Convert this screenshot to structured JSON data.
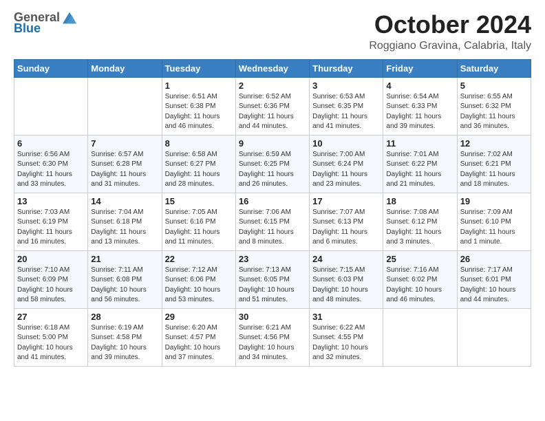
{
  "header": {
    "logo": {
      "general": "General",
      "blue": "Blue"
    },
    "title": "October 2024",
    "location": "Roggiano Gravina, Calabria, Italy"
  },
  "columns": [
    "Sunday",
    "Monday",
    "Tuesday",
    "Wednesday",
    "Thursday",
    "Friday",
    "Saturday"
  ],
  "weeks": [
    [
      {
        "day": "",
        "info": ""
      },
      {
        "day": "",
        "info": ""
      },
      {
        "day": "1",
        "info": "Sunrise: 6:51 AM\nSunset: 6:38 PM\nDaylight: 11 hours and 46 minutes."
      },
      {
        "day": "2",
        "info": "Sunrise: 6:52 AM\nSunset: 6:36 PM\nDaylight: 11 hours and 44 minutes."
      },
      {
        "day": "3",
        "info": "Sunrise: 6:53 AM\nSunset: 6:35 PM\nDaylight: 11 hours and 41 minutes."
      },
      {
        "day": "4",
        "info": "Sunrise: 6:54 AM\nSunset: 6:33 PM\nDaylight: 11 hours and 39 minutes."
      },
      {
        "day": "5",
        "info": "Sunrise: 6:55 AM\nSunset: 6:32 PM\nDaylight: 11 hours and 36 minutes."
      }
    ],
    [
      {
        "day": "6",
        "info": "Sunrise: 6:56 AM\nSunset: 6:30 PM\nDaylight: 11 hours and 33 minutes."
      },
      {
        "day": "7",
        "info": "Sunrise: 6:57 AM\nSunset: 6:28 PM\nDaylight: 11 hours and 31 minutes."
      },
      {
        "day": "8",
        "info": "Sunrise: 6:58 AM\nSunset: 6:27 PM\nDaylight: 11 hours and 28 minutes."
      },
      {
        "day": "9",
        "info": "Sunrise: 6:59 AM\nSunset: 6:25 PM\nDaylight: 11 hours and 26 minutes."
      },
      {
        "day": "10",
        "info": "Sunrise: 7:00 AM\nSunset: 6:24 PM\nDaylight: 11 hours and 23 minutes."
      },
      {
        "day": "11",
        "info": "Sunrise: 7:01 AM\nSunset: 6:22 PM\nDaylight: 11 hours and 21 minutes."
      },
      {
        "day": "12",
        "info": "Sunrise: 7:02 AM\nSunset: 6:21 PM\nDaylight: 11 hours and 18 minutes."
      }
    ],
    [
      {
        "day": "13",
        "info": "Sunrise: 7:03 AM\nSunset: 6:19 PM\nDaylight: 11 hours and 16 minutes."
      },
      {
        "day": "14",
        "info": "Sunrise: 7:04 AM\nSunset: 6:18 PM\nDaylight: 11 hours and 13 minutes."
      },
      {
        "day": "15",
        "info": "Sunrise: 7:05 AM\nSunset: 6:16 PM\nDaylight: 11 hours and 11 minutes."
      },
      {
        "day": "16",
        "info": "Sunrise: 7:06 AM\nSunset: 6:15 PM\nDaylight: 11 hours and 8 minutes."
      },
      {
        "day": "17",
        "info": "Sunrise: 7:07 AM\nSunset: 6:13 PM\nDaylight: 11 hours and 6 minutes."
      },
      {
        "day": "18",
        "info": "Sunrise: 7:08 AM\nSunset: 6:12 PM\nDaylight: 11 hours and 3 minutes."
      },
      {
        "day": "19",
        "info": "Sunrise: 7:09 AM\nSunset: 6:10 PM\nDaylight: 11 hours and 1 minute."
      }
    ],
    [
      {
        "day": "20",
        "info": "Sunrise: 7:10 AM\nSunset: 6:09 PM\nDaylight: 10 hours and 58 minutes."
      },
      {
        "day": "21",
        "info": "Sunrise: 7:11 AM\nSunset: 6:08 PM\nDaylight: 10 hours and 56 minutes."
      },
      {
        "day": "22",
        "info": "Sunrise: 7:12 AM\nSunset: 6:06 PM\nDaylight: 10 hours and 53 minutes."
      },
      {
        "day": "23",
        "info": "Sunrise: 7:13 AM\nSunset: 6:05 PM\nDaylight: 10 hours and 51 minutes."
      },
      {
        "day": "24",
        "info": "Sunrise: 7:15 AM\nSunset: 6:03 PM\nDaylight: 10 hours and 48 minutes."
      },
      {
        "day": "25",
        "info": "Sunrise: 7:16 AM\nSunset: 6:02 PM\nDaylight: 10 hours and 46 minutes."
      },
      {
        "day": "26",
        "info": "Sunrise: 7:17 AM\nSunset: 6:01 PM\nDaylight: 10 hours and 44 minutes."
      }
    ],
    [
      {
        "day": "27",
        "info": "Sunrise: 6:18 AM\nSunset: 5:00 PM\nDaylight: 10 hours and 41 minutes."
      },
      {
        "day": "28",
        "info": "Sunrise: 6:19 AM\nSunset: 4:58 PM\nDaylight: 10 hours and 39 minutes."
      },
      {
        "day": "29",
        "info": "Sunrise: 6:20 AM\nSunset: 4:57 PM\nDaylight: 10 hours and 37 minutes."
      },
      {
        "day": "30",
        "info": "Sunrise: 6:21 AM\nSunset: 4:56 PM\nDaylight: 10 hours and 34 minutes."
      },
      {
        "day": "31",
        "info": "Sunrise: 6:22 AM\nSunset: 4:55 PM\nDaylight: 10 hours and 32 minutes."
      },
      {
        "day": "",
        "info": ""
      },
      {
        "day": "",
        "info": ""
      }
    ]
  ]
}
